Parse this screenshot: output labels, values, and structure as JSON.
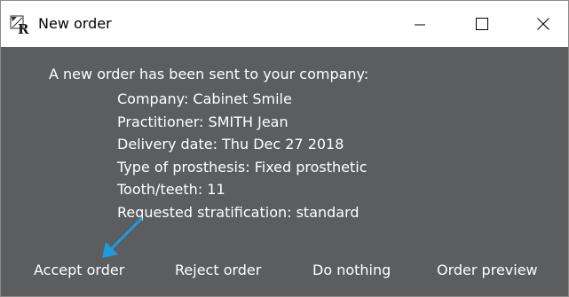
{
  "window": {
    "title": "New order",
    "controls": {
      "minimize_icon": "minimize-icon",
      "maximize_icon": "maximize-icon",
      "close_icon": "close-icon"
    }
  },
  "message": {
    "heading": "A new order has been sent to your company:",
    "details": [
      "Company: Cabinet Smile",
      "Practitioner: SMITH Jean",
      "Delivery date: Thu Dec 27 2018",
      "Type of prosthesis: Fixed prosthetic",
      "Tooth/teeth: 11",
      "Requested stratification: standard"
    ]
  },
  "actions": {
    "accept": "Accept order",
    "reject": "Reject order",
    "nothing": "Do nothing",
    "preview": "Order preview"
  },
  "colors": {
    "background": "#5b5d5e",
    "text": "#ffffff",
    "arrow": "#1e9be0",
    "titlebar": "#ffffff"
  }
}
